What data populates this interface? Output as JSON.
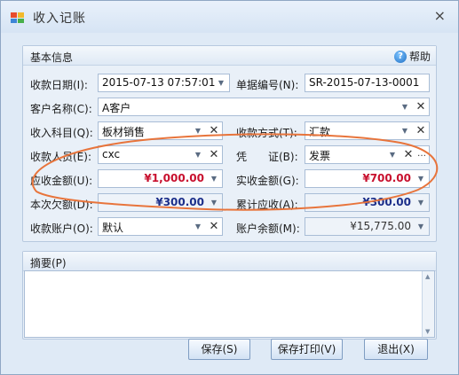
{
  "window": {
    "title": "收入记账",
    "close": "×"
  },
  "basic": {
    "title": "基本信息",
    "help": "帮助",
    "fields": {
      "date_label": "收款日期(I):",
      "date_value": "2015-07-13 07:57:01",
      "billno_label": "单据编号(N):",
      "billno_value": "SR-2015-07-13-0001",
      "customer_label": "客户名称(C):",
      "customer_value": "A客户",
      "subject_label": "收入科目(Q):",
      "subject_value": "板材销售",
      "method_label": "收款方式(T):",
      "method_value": "汇款",
      "payee_label": "收款人员(E):",
      "payee_value": "cxc",
      "voucher_label": "凭　　证(B):",
      "voucher_value": "发票",
      "receivable_label": "应收金额(U):",
      "receivable_value": "¥1,000.00",
      "received_label": "实收金额(G):",
      "received_value": "¥700.00",
      "arrears_label": "本次欠额(D):",
      "arrears_value": "¥300.00",
      "cumulative_label": "累计应收(A):",
      "cumulative_value": "¥300.00",
      "account_label": "收款账户(O):",
      "account_value": "默认",
      "balance_label": "账户余额(M):",
      "balance_value": "¥15,775.00"
    }
  },
  "memo": {
    "title": "摘要(P)",
    "value": ""
  },
  "buttons": {
    "save": "保存(S)",
    "save_print": "保存打印(V)",
    "exit": "退出(X)"
  },
  "colors": {
    "annotation_ellipse": "#e8743b",
    "amount_red": "#c8102e",
    "amount_blue": "#1c2f8a"
  },
  "icons": [
    "app-icon",
    "help-icon",
    "dropdown-arrow-icon",
    "clear-x-icon",
    "ellipsis-icon",
    "close-icon"
  ]
}
